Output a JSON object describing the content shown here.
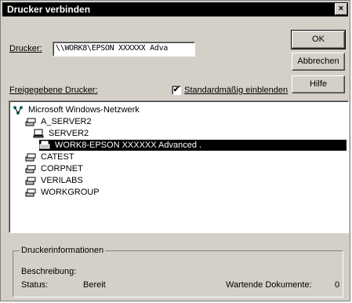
{
  "window": {
    "title": "Drucker verbinden",
    "close_label": "×"
  },
  "printer_field": {
    "label": "Drucker:",
    "value": "\\\\WORK8\\EPSON XXXXXX Adva"
  },
  "buttons": {
    "ok": "OK",
    "cancel": "Abbrechen",
    "help": "Hilfe"
  },
  "shared_label": "Freigegebene Drucker:",
  "expand_checkbox": {
    "label": "Standardmäßig einblenden",
    "checked": true,
    "mark": "✔"
  },
  "tree": {
    "items": [
      {
        "label": "Microsoft Windows-Netzwerk",
        "icon": "network-icon"
      },
      {
        "label": "A_SERVER2",
        "icon": "domain-icon"
      },
      {
        "label": "SERVER2",
        "icon": "computer-icon"
      },
      {
        "label": "WORK8-EPSON XXXXXX Advanced .",
        "icon": "printer-icon",
        "selected": true
      },
      {
        "label": "CATEST",
        "icon": "domain-icon"
      },
      {
        "label": "CORPNET",
        "icon": "domain-icon"
      },
      {
        "label": "VERILABS",
        "icon": "domain-icon"
      },
      {
        "label": "WORKGROUP",
        "icon": "domain-icon"
      }
    ]
  },
  "info": {
    "title": "Druckerinformationen",
    "description_label": "Beschreibung:",
    "status_label": "Status:",
    "status_value": "Bereit",
    "queue_label": "Wartende Dokumente:",
    "queue_value": "0"
  }
}
